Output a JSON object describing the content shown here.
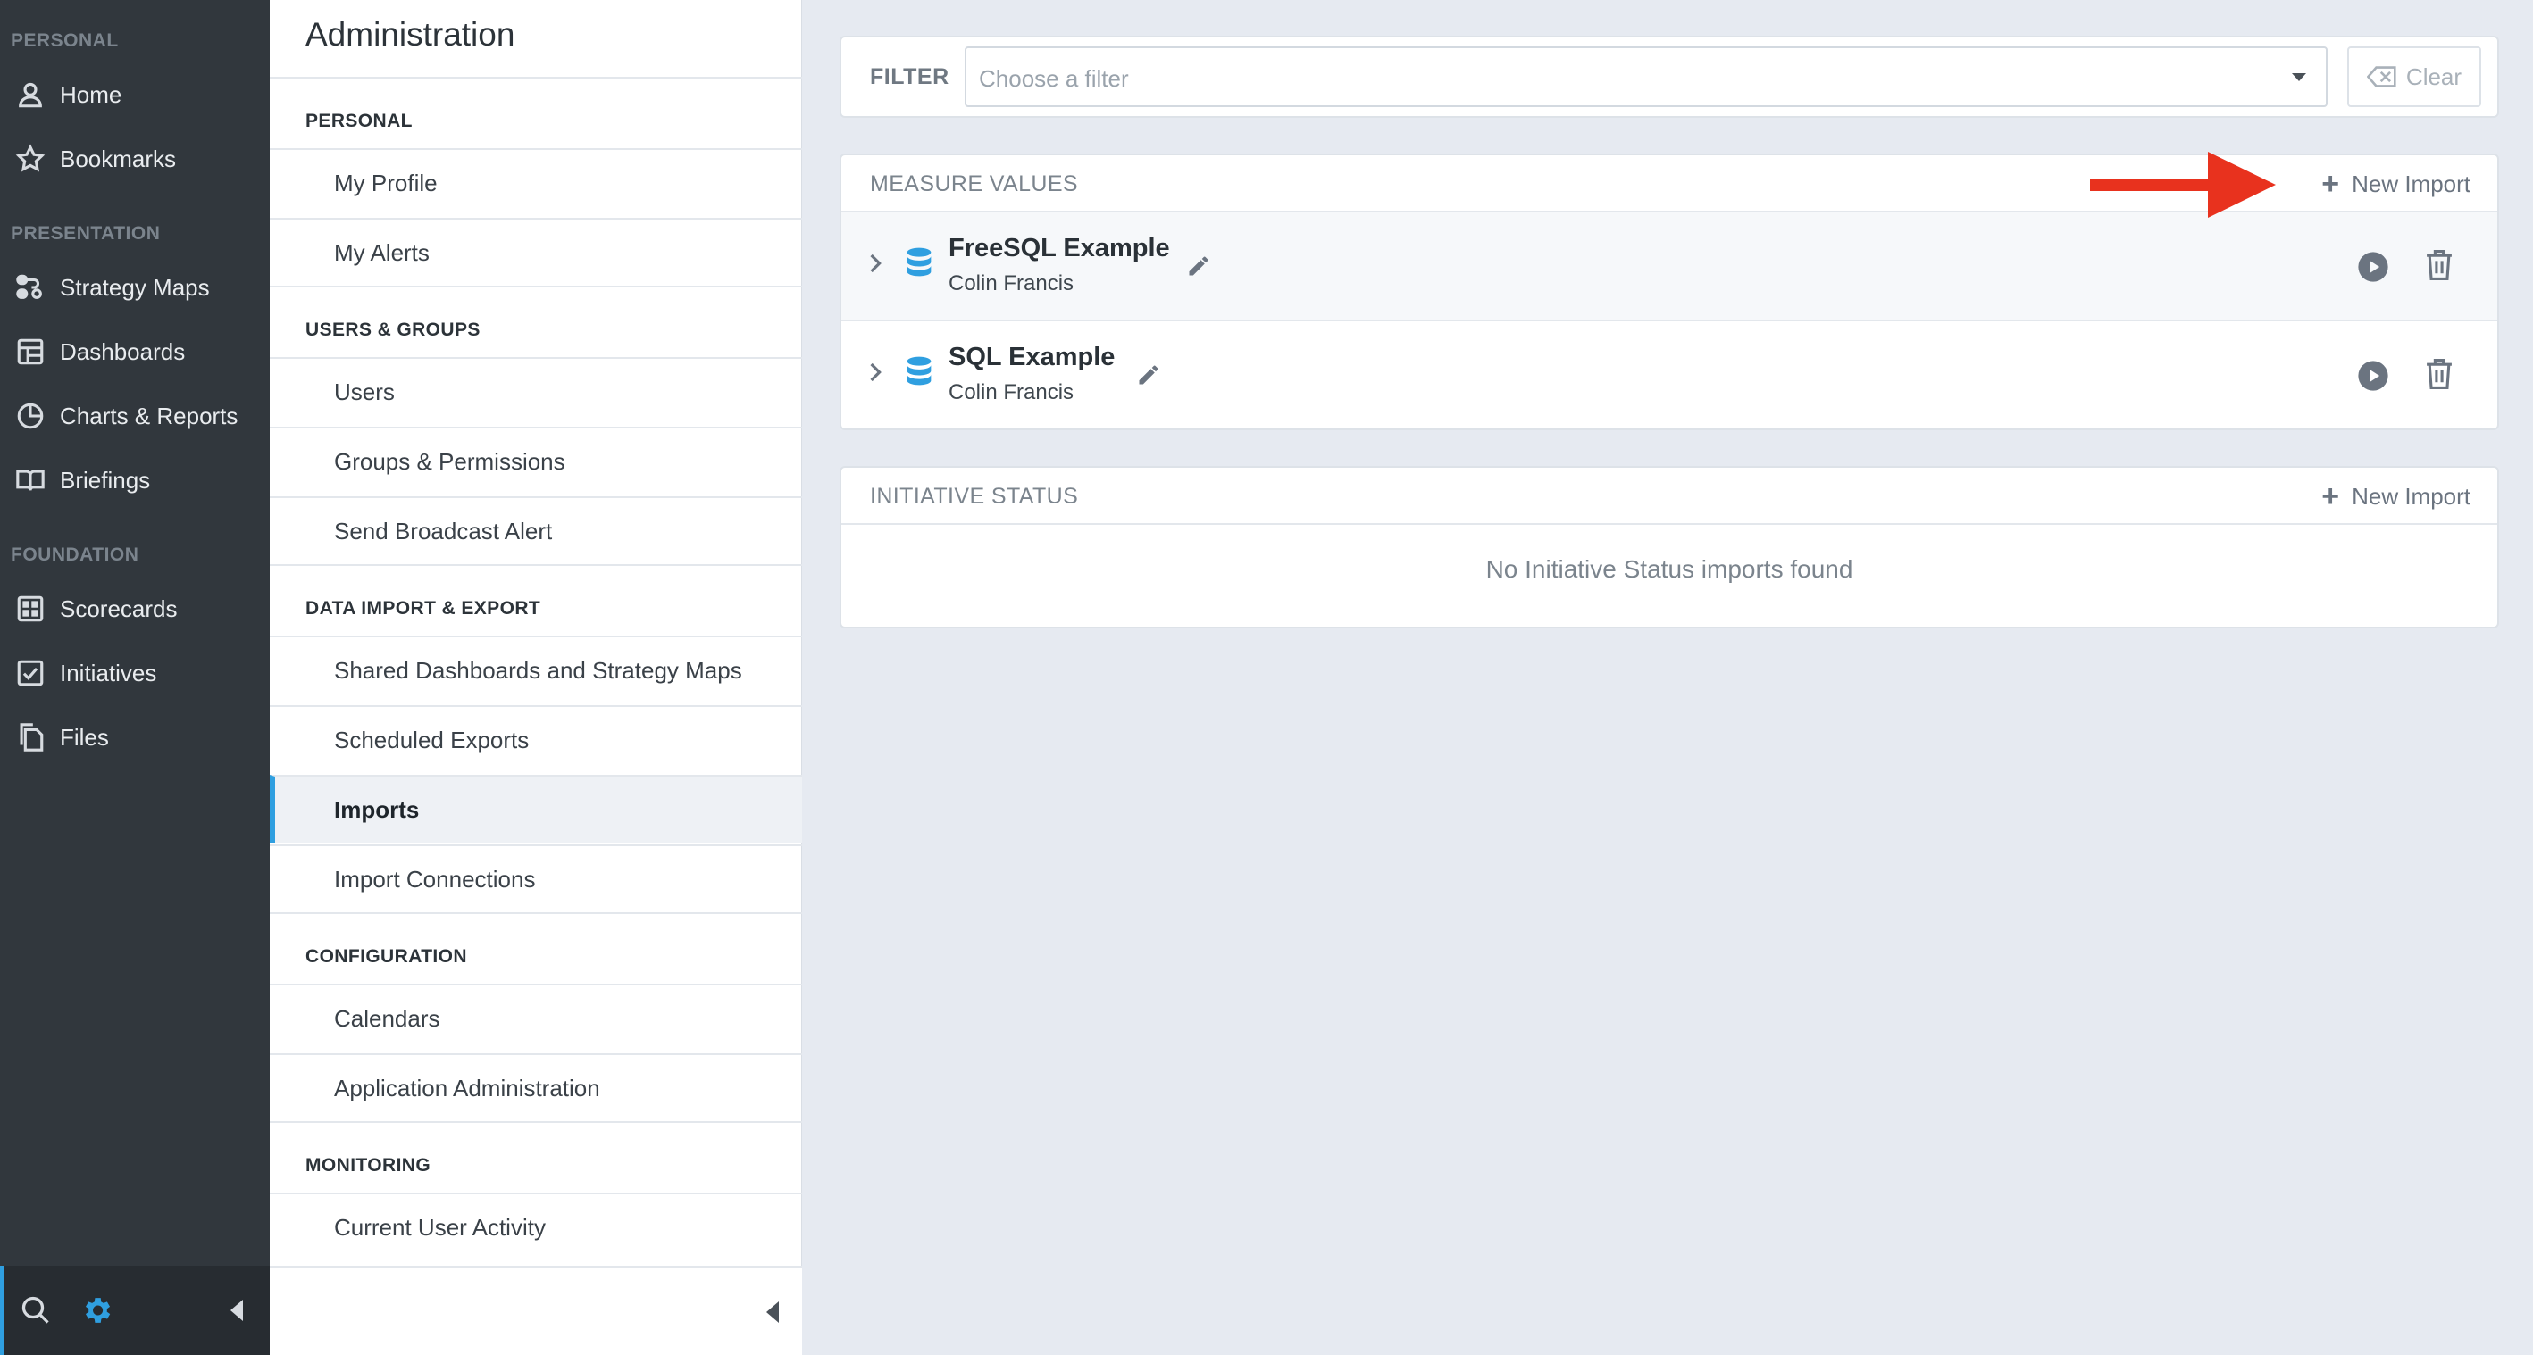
{
  "nav": {
    "sections": [
      "PERSONAL",
      "PRESENTATION",
      "FOUNDATION"
    ],
    "items": [
      {
        "label": "Home",
        "icon": "user-icon"
      },
      {
        "label": "Bookmarks",
        "icon": "star-icon"
      },
      {
        "label": "Strategy Maps",
        "icon": "strategy-map-icon"
      },
      {
        "label": "Dashboards",
        "icon": "dashboard-icon"
      },
      {
        "label": "Charts & Reports",
        "icon": "pie-chart-icon"
      },
      {
        "label": "Briefings",
        "icon": "book-icon"
      },
      {
        "label": "Scorecards",
        "icon": "scorecard-icon"
      },
      {
        "label": "Initiatives",
        "icon": "checkbox-icon"
      },
      {
        "label": "Files",
        "icon": "files-icon"
      }
    ],
    "accent_color": "#2f9fe0"
  },
  "admin": {
    "title": "Administration",
    "sections": [
      {
        "label": "PERSONAL",
        "items": [
          "My Profile",
          "My Alerts"
        ]
      },
      {
        "label": "USERS & GROUPS",
        "items": [
          "Users",
          "Groups & Permissions",
          "Send Broadcast Alert"
        ]
      },
      {
        "label": "DATA IMPORT & EXPORT",
        "items": [
          "Shared Dashboards and Strategy Maps",
          "Scheduled Exports",
          "Imports",
          "Import Connections"
        ]
      },
      {
        "label": "CONFIGURATION",
        "items": [
          "Calendars",
          "Application Administration"
        ]
      },
      {
        "label": "MONITORING",
        "items": [
          "Current User Activity"
        ]
      }
    ],
    "active_item": "Imports"
  },
  "filter": {
    "label": "FILTER",
    "placeholder": "Choose a filter",
    "clear_label": "Clear"
  },
  "measure_values": {
    "title": "MEASURE VALUES",
    "new_import_label": "New Import",
    "imports": [
      {
        "name": "FreeSQL Example",
        "owner": "Colin Francis"
      },
      {
        "name": "SQL Example",
        "owner": "Colin Francis"
      }
    ]
  },
  "initiative_status": {
    "title": "INITIATIVE STATUS",
    "new_import_label": "New Import",
    "empty_message": "No Initiative Status imports found"
  },
  "annotation_color": "#e8321e"
}
